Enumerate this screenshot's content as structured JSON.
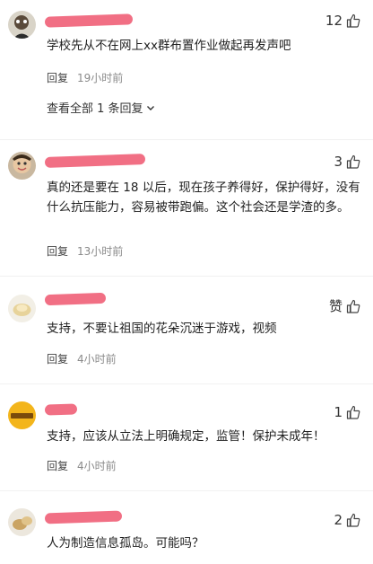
{
  "comments": [
    {
      "likes": "12",
      "text": "学校先从不在网上xx群布置作业做起再发声吧",
      "reply_label": "回复",
      "time": "19小时前",
      "view_all": "查看全部 1 条回复"
    },
    {
      "likes": "3",
      "text": "真的还是要在 18 以后，现在孩子养得好，保护得好，没有什么抗压能力，容易被带跑偏。这个社会还是学渣的多。",
      "reply_label": "回复",
      "time": "13小时前"
    },
    {
      "likes": "赞",
      "text": "支持，不要让祖国的花朵沉迷于游戏，视频",
      "reply_label": "回复",
      "time": "4小时前"
    },
    {
      "likes": "1",
      "text": "支持，应该从立法上明确规定，监管！保护未成年！",
      "reply_label": "回复",
      "time": "4小时前"
    },
    {
      "likes": "2",
      "text": "人为制造信息孤岛。可能吗？"
    }
  ],
  "icons": {
    "like": "thumbs-up-icon",
    "expand": "chevron-down-icon"
  },
  "colors": {
    "redaction": "#f0637a",
    "meta": "#8a8a8a"
  }
}
